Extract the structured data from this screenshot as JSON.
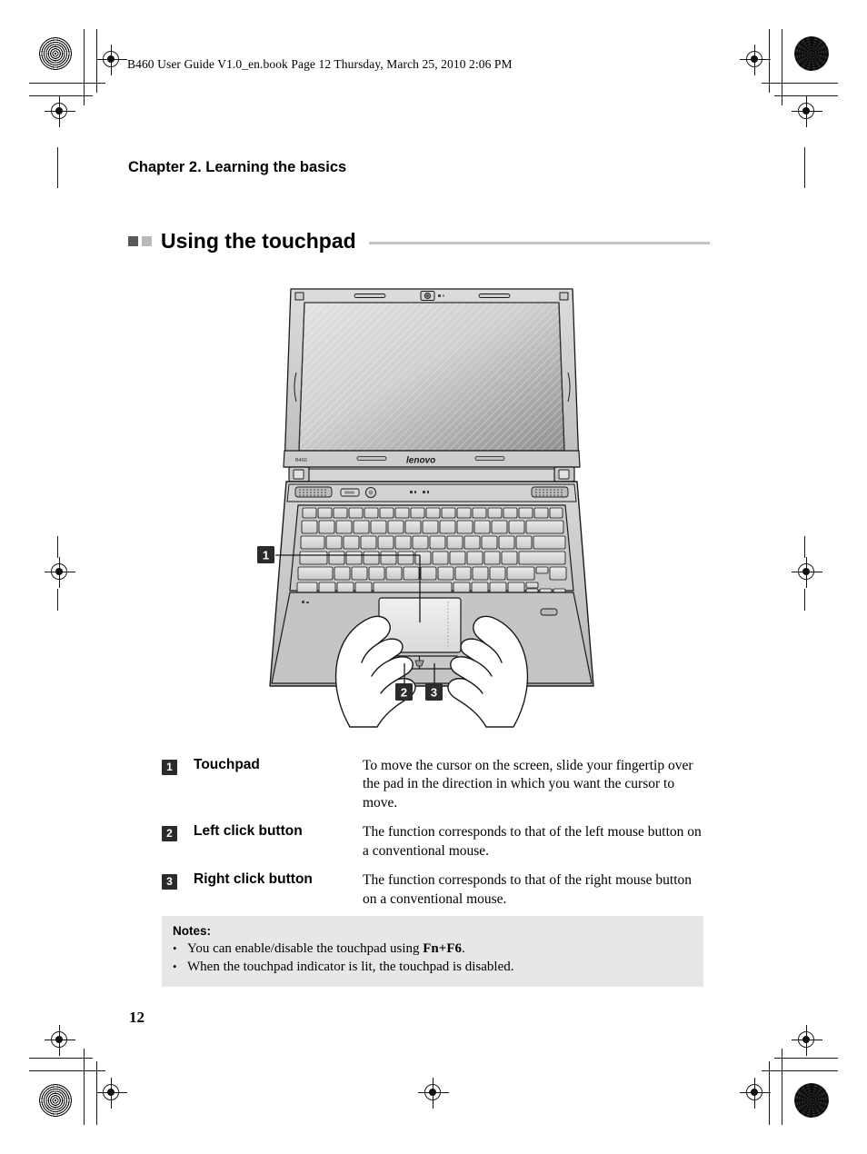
{
  "page": {
    "header_line": "B460 User Guide V1.0_en.book  Page 12  Thursday, March 25, 2010  2:06 PM",
    "chapter_title": "Chapter 2. Learning the basics",
    "section_title": "Using the touchpad",
    "page_number": "12"
  },
  "illustration": {
    "alt": "Lenovo B460 notebook seen from above with two hands resting on the keyboard, fingers on the touchpad and click buttons",
    "brand_logo": "lenovo",
    "model_label": "B460",
    "callout_markers": [
      "1",
      "2",
      "3"
    ]
  },
  "callouts": [
    {
      "number": "1",
      "label": "Touchpad",
      "description": "To move the cursor on the screen, slide your fingertip over the pad in the direction in which you want the cursor to move."
    },
    {
      "number": "2",
      "label": "Left click button",
      "description": "The function corresponds to that of the left mouse button on a conventional mouse."
    },
    {
      "number": "3",
      "label": "Right click button",
      "description": "The function corresponds to that of the right mouse button on a conventional mouse."
    }
  ],
  "notes": {
    "title": "Notes:",
    "bullet_glyph": "•",
    "items": [
      {
        "text_before": "You can enable/disable the touchpad using ",
        "bold": "Fn+F6",
        "text_after": "."
      },
      {
        "text_before": "When the touchpad indicator is lit, the touchpad is disabled.",
        "bold": "",
        "text_after": ""
      }
    ]
  },
  "colors": {
    "bullet_dark": "#595959",
    "bullet_light": "#b9b9b9",
    "rule": "#c4c4c4",
    "badge_bg": "#2b2b2b",
    "notes_bg": "#e7e7e7"
  }
}
